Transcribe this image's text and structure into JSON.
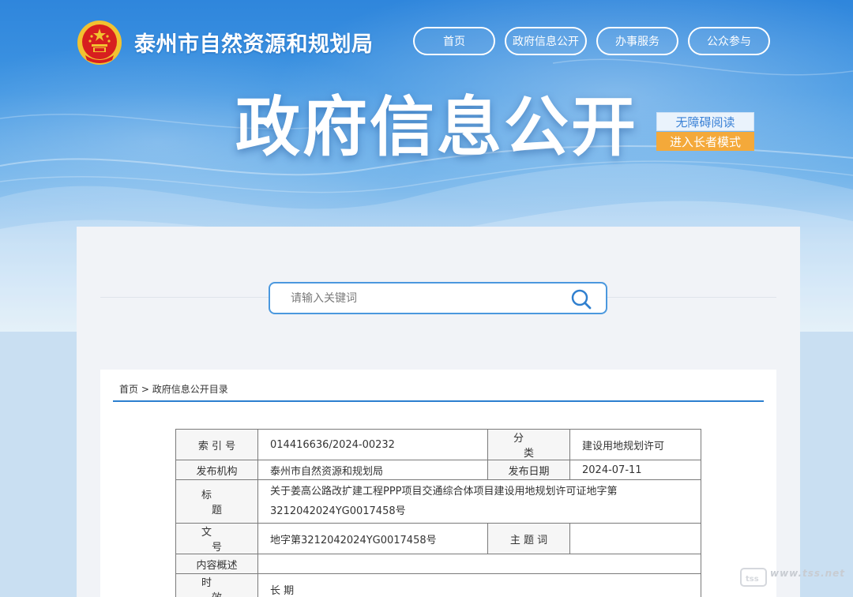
{
  "header": {
    "site_title": "泰州市自然资源和规划局",
    "nav": [
      {
        "label": "首页"
      },
      {
        "label": "政府信息公开"
      },
      {
        "label": "办事服务"
      },
      {
        "label": "公众参与"
      }
    ],
    "hero_title": "政府信息公开",
    "accessibility": {
      "barrier_free": "无障碍阅读",
      "elderly_mode": "进入长者模式"
    }
  },
  "search": {
    "placeholder": "请输入关键词"
  },
  "breadcrumb": {
    "home": "首页",
    "separator": ">",
    "current": "政府信息公开目录"
  },
  "meta_table": {
    "index_label": "索 引 号",
    "index_value": "014416636/2024-00232",
    "category_label": "分 类",
    "category_value": "建设用地规划许可",
    "publisher_label": "发布机构",
    "publisher_value": "泰州市自然资源和规划局",
    "date_label": "发布日期",
    "date_value": "2024-07-11",
    "title_label": "标 题",
    "title_value": "关于姜高公路改扩建工程PPP项目交通综合体项目建设用地规划许可证地字第3212042024YG0017458号",
    "docno_label": "文 号",
    "docno_value": "地字第3212042024YG0017458号",
    "keyword_label": "主 题 词",
    "keyword_value": "",
    "summary_label": "内容概述",
    "summary_value": "",
    "validity_label": "时 效",
    "validity_value": "长 期"
  },
  "colors": {
    "banner_top": "#2f86dc",
    "accent_blue": "#2c7fcf",
    "search_border": "#4b98de",
    "elderly_btn": "#f4a93a",
    "emblem_red": "#d71f1f",
    "emblem_gold": "#f2c230"
  },
  "watermark": {
    "text": "www.tss.net",
    "badge": "tss"
  }
}
